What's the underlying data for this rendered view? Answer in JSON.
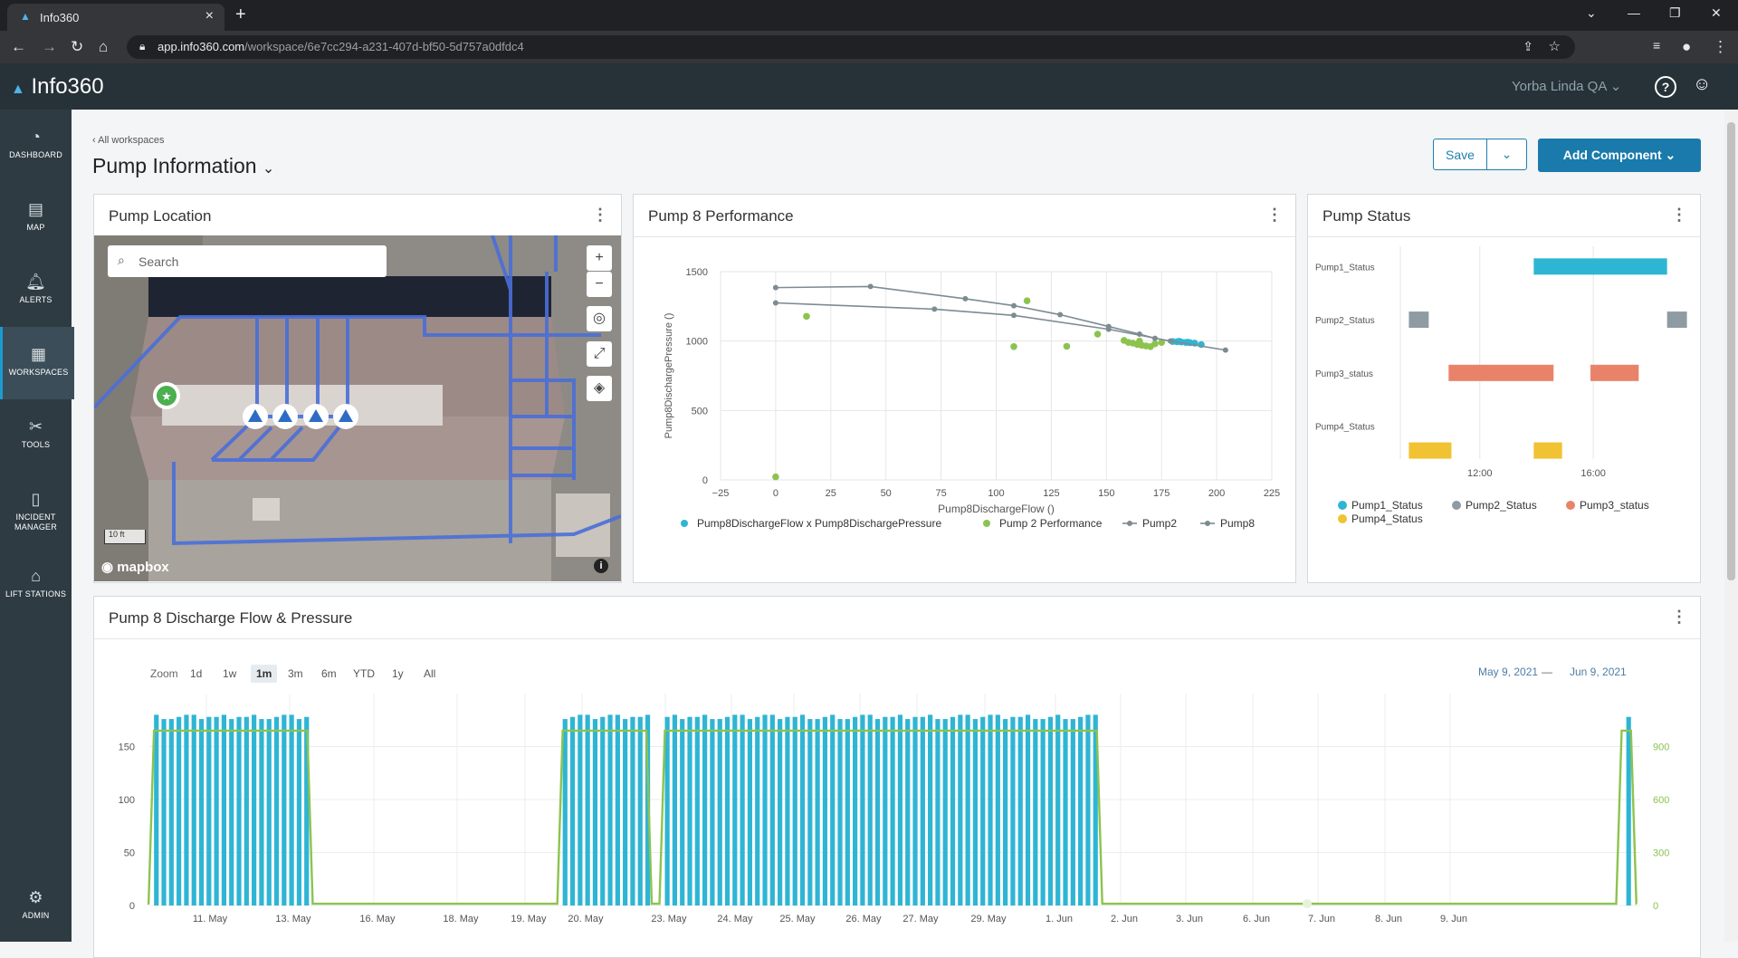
{
  "browser": {
    "tab_title": "Info360",
    "url_host": "app.info360.com",
    "url_path": "/workspace/6e7cc294-a231-407d-bf50-5d757a0dfdc4"
  },
  "app": {
    "logo": "Info360",
    "org_name": "Yorba Linda QA"
  },
  "sidebar": {
    "items": [
      {
        "label": "DASHBOARD",
        "icon": "dashboard-icon"
      },
      {
        "label": "MAP",
        "icon": "map-icon"
      },
      {
        "label": "ALERTS",
        "icon": "alerts-icon"
      },
      {
        "label": "WORKSPACES",
        "icon": "workspaces-icon"
      },
      {
        "label": "TOOLS",
        "icon": "tools-icon"
      },
      {
        "label": "INCIDENT",
        "label2": "MANAGER",
        "icon": "incident-icon"
      },
      {
        "label": "LIFT STATIONS",
        "icon": "lift-station-icon"
      },
      {
        "label": "ADMIN",
        "icon": "gear-icon"
      }
    ]
  },
  "page": {
    "breadcrumb": "All workspaces",
    "title": "Pump Information",
    "save_label": "Save",
    "add_component_label": "Add Component"
  },
  "map_panel": {
    "title": "Pump Location",
    "search_placeholder": "Search",
    "scale": "10 ft",
    "attribution": "mapbox"
  },
  "performance_panel": {
    "title": "Pump 8 Performance"
  },
  "status_panel": {
    "title": "Pump Status"
  },
  "flow_panel": {
    "title": "Pump 8 Discharge Flow & Pressure",
    "zoom_label": "Zoom",
    "zoom_options": [
      "1d",
      "1w",
      "1m",
      "3m",
      "6m",
      "YTD",
      "1y",
      "All"
    ],
    "zoom_selected": "1m",
    "range_from": "May 9, 2021",
    "range_sep": "—",
    "range_to": "Jun 9, 2021"
  },
  "chart_data": [
    {
      "type": "scatter",
      "xlabel": "Pump8DischargeFlow ()",
      "ylabel": "Pump8DischargePressure ()",
      "xlim": [
        -25,
        225
      ],
      "ylim": [
        0,
        1500
      ],
      "x_ticks": [
        "−25",
        "0",
        "25",
        "50",
        "75",
        "100",
        "125",
        "150",
        "175",
        "200",
        "225"
      ],
      "y_ticks": [
        "0",
        "500",
        "1000",
        "1500"
      ],
      "series": [
        {
          "name": "Pump8DischargeFlow x Pump8DischargePressure",
          "color": "#2fb5d4",
          "kind": "scatter",
          "points": [
            [
              180,
              997
            ],
            [
              182,
              995
            ],
            [
              184,
              993
            ],
            [
              186,
              990
            ],
            [
              188,
              988
            ],
            [
              190,
              985
            ],
            [
              183,
              998
            ],
            [
              187,
              992
            ],
            [
              193,
              975
            ]
          ]
        },
        {
          "name": "Pump 2 Performance",
          "color": "#8cc34f",
          "kind": "scatter",
          "points": [
            [
              0,
              22
            ],
            [
              14,
              1178
            ],
            [
              114,
              1290
            ],
            [
              108,
              960
            ],
            [
              132,
              962
            ],
            [
              146,
              1050
            ],
            [
              158,
              1005
            ],
            [
              160,
              990
            ],
            [
              162,
              985
            ],
            [
              164,
              975
            ],
            [
              166,
              970
            ],
            [
              168,
              965
            ],
            [
              170,
              960
            ],
            [
              172,
              980
            ],
            [
              165,
              1000
            ],
            [
              175,
              990
            ]
          ]
        },
        {
          "name": "Pump2",
          "color": "#7d8b93",
          "kind": "line",
          "points": [
            [
              0,
              1385
            ],
            [
              43,
              1393
            ],
            [
              86,
              1305
            ],
            [
              108,
              1255
            ],
            [
              129,
              1190
            ],
            [
              151,
              1105
            ],
            [
              165,
              1050
            ],
            [
              172,
              1020
            ]
          ]
        },
        {
          "name": "Pump8",
          "color": "#7d8b93",
          "kind": "line",
          "points": [
            [
              0,
              1275
            ],
            [
              72,
              1230
            ],
            [
              108,
              1185
            ],
            [
              151,
              1085
            ],
            [
              179,
              1000
            ],
            [
              204,
              935
            ]
          ]
        }
      ]
    },
    {
      "type": "bar",
      "subtype": "timeline",
      "categories": [
        "Pump1_Status",
        "Pump2_Status",
        "Pump3_status",
        "Pump4_Status"
      ],
      "x_ticks": [
        "12:00",
        "16:00"
      ],
      "series": [
        {
          "name": "Pump1_Status",
          "color": "#2fb5d4",
          "intervals": [
            [
              13.9,
              18.6
            ]
          ]
        },
        {
          "name": "Pump2_Status",
          "color": "#8e9ba3",
          "intervals": [
            [
              9.5,
              10.2
            ],
            [
              18.6,
              19.3
            ]
          ]
        },
        {
          "name": "Pump3_status",
          "color": "#e8836a",
          "intervals": [
            [
              10.9,
              14.6
            ],
            [
              15.9,
              17.6
            ]
          ]
        },
        {
          "name": "Pump4_Status",
          "color": "#f1c232",
          "intervals": [
            [
              9.5,
              11.0
            ],
            [
              13.9,
              14.9
            ]
          ]
        }
      ]
    },
    {
      "type": "bar",
      "subtype": "bar+line",
      "x_ticks": [
        "11. May",
        "13. May",
        "16. May",
        "18. May",
        "19. May",
        "20. May",
        "23. May",
        "24. May",
        "25. May",
        "26. May",
        "27. May",
        "29. May",
        "1. Jun",
        "2. Jun",
        "3. Jun",
        "6. Jun",
        "7. Jun",
        "8. Jun",
        "9. Jun"
      ],
      "y_left_ticks": [
        "0",
        "50",
        "100",
        "150"
      ],
      "y_right_ticks": [
        "0",
        "300",
        "600",
        "900"
      ],
      "ylim_left": [
        0,
        200
      ],
      "ylim_right": [
        0,
        1200
      ],
      "series": [
        {
          "name": "Pump8DischargeFlow",
          "color": "#2fb5d4",
          "kind": "bar",
          "axis": "left",
          "value_when_on": 180,
          "on_ranges": [
            [
              9.1,
              12.4
            ],
            [
              17.9,
              19.7
            ],
            [
              20.1,
              29.4
            ],
            [
              40.8,
              40.9
            ]
          ]
        },
        {
          "name": "Pump8DischargePressure",
          "color": "#8cc34f",
          "kind": "line",
          "axis": "right",
          "value_when_on": 990,
          "value_when_off": 10,
          "on_ranges": [
            [
              9.1,
              12.4
            ],
            [
              17.9,
              19.7
            ],
            [
              20.1,
              29.4
            ],
            [
              40.7,
              40.9
            ]
          ]
        }
      ]
    }
  ]
}
